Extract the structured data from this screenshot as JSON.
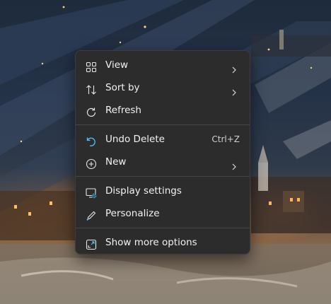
{
  "context_menu": {
    "items": [
      {
        "label": "View",
        "icon": "grid-view-icon",
        "has_submenu": true
      },
      {
        "label": "Sort by",
        "icon": "sort-arrows-icon",
        "has_submenu": true
      },
      {
        "label": "Refresh",
        "icon": "refresh-icon",
        "has_submenu": false
      },
      {
        "label": "Undo Delete",
        "icon": "undo-icon",
        "shortcut": "Ctrl+Z",
        "has_submenu": false
      },
      {
        "label": "New",
        "icon": "plus-circle-icon",
        "has_submenu": true
      },
      {
        "label": "Display settings",
        "icon": "display-settings-icon",
        "has_submenu": false
      },
      {
        "label": "Personalize",
        "icon": "pen-icon",
        "has_submenu": false
      },
      {
        "label": "Show more options",
        "icon": "expand-icon",
        "has_submenu": false
      }
    ]
  },
  "colors": {
    "menu_background": "#2c2c2c",
    "menu_text": "#f2f2f2",
    "accent": "#4cc2ff"
  }
}
